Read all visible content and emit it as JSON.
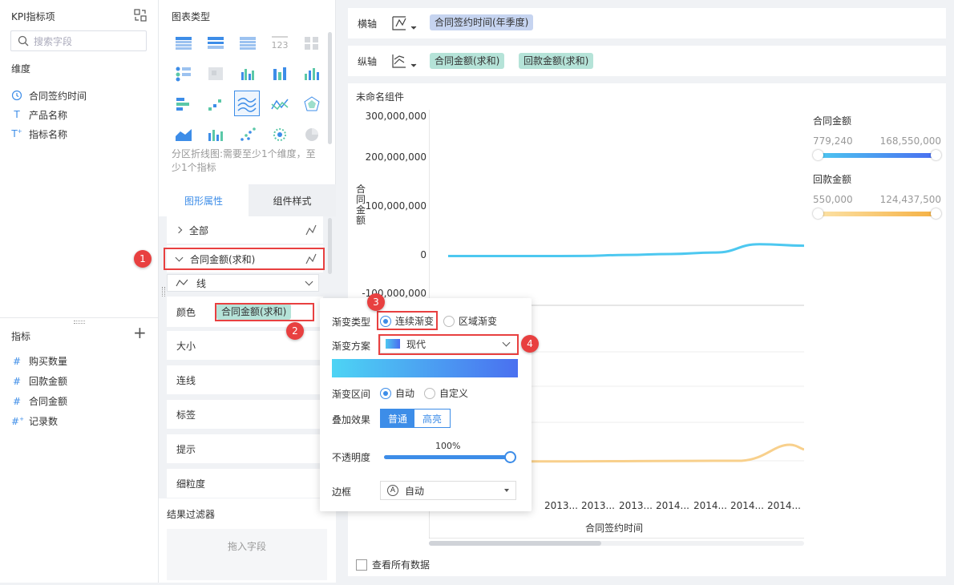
{
  "left_panel": {
    "title": "KPI指标项",
    "search_placeholder": "搜索字段",
    "dimension_title": "维度",
    "dimensions": [
      {
        "label": "合同签约时间",
        "icon": "clock-icon"
      },
      {
        "label": "产品名称",
        "icon": "text-field-icon"
      },
      {
        "label": "指标名称",
        "icon": "text-field-icon"
      }
    ],
    "metric_title": "指标",
    "metrics": [
      {
        "label": "购买数量"
      },
      {
        "label": "回款金额"
      },
      {
        "label": "合同金额"
      },
      {
        "label": "记录数"
      }
    ]
  },
  "mid_panel": {
    "chart_type_title": "图表类型",
    "chart_hint": "分区折线图:需要至少1个维度，至少1个指标",
    "tabs": [
      "图形属性",
      "组件样式"
    ],
    "all_label": "全部",
    "series_label": "合同金额(求和)",
    "line_type": "线",
    "color_label": "颜色",
    "color_pill": "合同金额(求和)",
    "rows": [
      "大小",
      "连线",
      "标签",
      "提示",
      "细粒度"
    ],
    "filter_title": "结果过滤器",
    "drag_hint": "拖入字段"
  },
  "axes": {
    "x_label": "横轴",
    "x_field": "合同签约时间(年季度)",
    "y_label": "纵轴",
    "y_fields": [
      "合同金额(求和)",
      "回款金额(求和)"
    ]
  },
  "chart_data": {
    "type": "line",
    "title": "未命名组件",
    "ylabel": "合同金额",
    "xlabel": "合同签约时间",
    "y_ticks": [
      "300,000,000",
      "200,000,000",
      "100,000,000",
      "0",
      "-100,000,000"
    ],
    "x_ticks": [
      "2013...",
      "2013...",
      "2013...",
      "2014...",
      "2014...",
      "2014...",
      "2014..."
    ],
    "ylim": [
      -100000000,
      300000000
    ],
    "series": [
      {
        "name": "合同金额",
        "color": "#4dc8f0",
        "values": [
          779240,
          900000,
          800000,
          1000000,
          3000000,
          5000000,
          8000000,
          25000000,
          22000000
        ]
      },
      {
        "name": "回款金额",
        "color": "#f8d08c"
      }
    ]
  },
  "legend": [
    {
      "name": "合同金额",
      "min": "779,240",
      "max": "168,550,000",
      "gradient": [
        "#4dc8f0",
        "#4a6cf0"
      ]
    },
    {
      "name": "回款金额",
      "min": "550,000",
      "max": "124,437,500",
      "gradient": [
        "#fce3a8",
        "#f5b042"
      ]
    }
  ],
  "popup": {
    "gradient_type_label": "渐变类型",
    "gradient_continuous": "连续渐变",
    "gradient_region": "区域渐变",
    "scheme_label": "渐变方案",
    "scheme_value": "现代",
    "interval_label": "渐变区间",
    "interval_auto": "自动",
    "interval_custom": "自定义",
    "overlay_label": "叠加效果",
    "overlay_normal": "普通",
    "overlay_highlight": "高亮",
    "opacity_label": "不透明度",
    "opacity_value": "100%",
    "opacity": 1.0,
    "border_label": "边框",
    "border_value": "自动"
  },
  "badges": [
    "1",
    "2",
    "3",
    "4"
  ],
  "footer": {
    "view_all": "查看所有数据"
  },
  "colors": {
    "accent": "#3d8de8",
    "annotation": "#e84040",
    "x_pill": "#c6d4f0",
    "y_pill": "#b5e3d8"
  }
}
